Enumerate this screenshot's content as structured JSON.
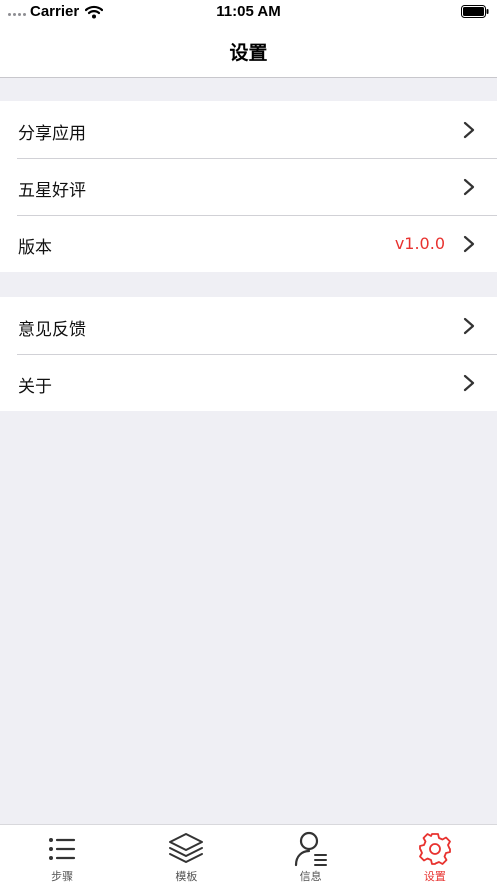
{
  "status_bar": {
    "carrier": "Carrier",
    "time": "11:05 AM"
  },
  "nav": {
    "title": "设置"
  },
  "groups": [
    {
      "rows": [
        {
          "label": "分享应用",
          "value": ""
        },
        {
          "label": "五星好评",
          "value": ""
        },
        {
          "label": "版本",
          "value": "v1.0.0"
        }
      ]
    },
    {
      "rows": [
        {
          "label": "意见反馈",
          "value": ""
        },
        {
          "label": "关于",
          "value": ""
        }
      ]
    }
  ],
  "tabs": [
    {
      "label": "步骤",
      "icon": "list-icon",
      "active": false
    },
    {
      "label": "模板",
      "icon": "layers-icon",
      "active": false
    },
    {
      "label": "信息",
      "icon": "user-info-icon",
      "active": false
    },
    {
      "label": "设置",
      "icon": "gear-icon",
      "active": true
    }
  ],
  "colors": {
    "accent": "#e8322f",
    "background": "#efeff4",
    "tab_inactive": "#333333"
  }
}
